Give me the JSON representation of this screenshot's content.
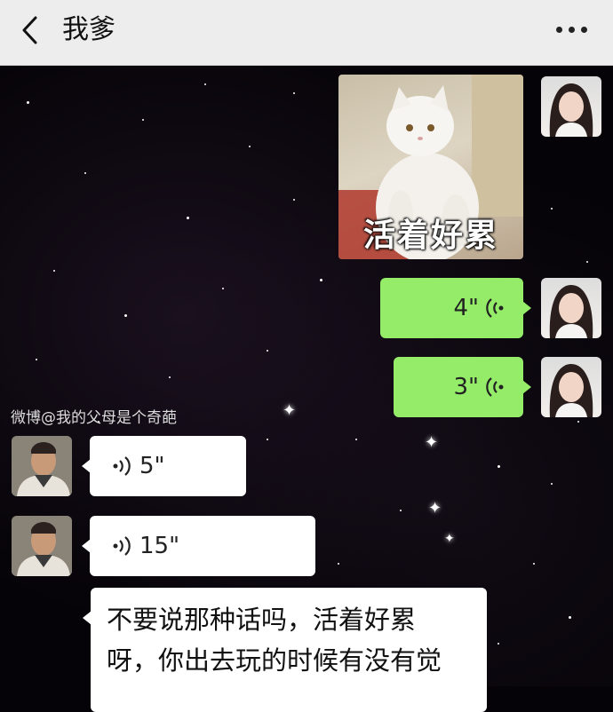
{
  "header": {
    "title": "我爹",
    "back_icon": "chevron-left-icon",
    "more_icon": "more-dots-icon",
    "background": "#ededed"
  },
  "watermark": "微博@我的父母是个奇葩",
  "messages": [
    {
      "type": "sticker",
      "from": "me",
      "caption": "活着好累"
    },
    {
      "type": "voice",
      "from": "me",
      "duration": "4\""
    },
    {
      "type": "voice",
      "from": "me",
      "duration": "3\""
    },
    {
      "type": "voice",
      "from": "dad",
      "duration": "5\""
    },
    {
      "type": "voice",
      "from": "dad",
      "duration": "15\""
    },
    {
      "type": "text",
      "from": "dad",
      "lines": [
        "不要说那种话吗，活着好累",
        "呀，你出去玩的时候有没有觉"
      ]
    }
  ],
  "colors": {
    "sent_bubble": "#95ec69",
    "received_bubble": "#ffffff",
    "chat_background": "#050307"
  }
}
